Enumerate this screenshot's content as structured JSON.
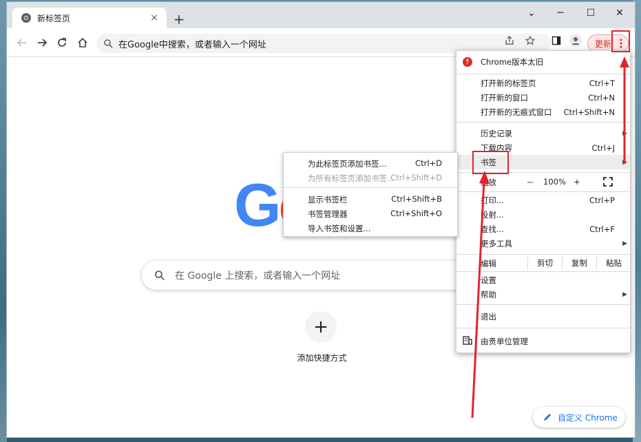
{
  "tab": {
    "title": "新标签页",
    "favicon": "chrome-icon",
    "close": "×"
  },
  "newtab": "+",
  "window_controls": {
    "minimize": "─",
    "maximize": "☐",
    "close": "✕",
    "tabsearch": "⌄"
  },
  "omnibox": {
    "text": "在Google中搜索，或者输入一个网址"
  },
  "update_button": {
    "label": "更新"
  },
  "page": {
    "logo_letters": [
      {
        "ch": "G",
        "color": "#4285f4"
      },
      {
        "ch": "o",
        "color": "#ea4335"
      }
    ],
    "search_placeholder": "在 Google 上搜索，或者输入一个网址",
    "shortcut_add": "+",
    "shortcut_label": "添加快捷方式",
    "customize_label": "自定义 Chrome"
  },
  "menu": {
    "update_notice": "Chrome版本太旧",
    "items_group1": [
      {
        "label": "打开新的标签页",
        "shortcut": "Ctrl+T"
      },
      {
        "label": "打开新的窗口",
        "shortcut": "Ctrl+N"
      },
      {
        "label": "打开新的无痕式窗口",
        "shortcut": "Ctrl+Shift+N"
      }
    ],
    "history": "历史记录",
    "downloads": {
      "label": "下载内容",
      "shortcut": "Ctrl+J"
    },
    "bookmarks": "书签",
    "zoom": {
      "label": "缩放",
      "minus": "－",
      "value": "100%",
      "plus": "+"
    },
    "items_group3": [
      {
        "label": "打印...",
        "shortcut": "Ctrl+P"
      },
      {
        "label": "投射...",
        "shortcut": ""
      },
      {
        "label": "查找...",
        "shortcut": "Ctrl+F"
      },
      {
        "label": "更多工具",
        "shortcut": ""
      }
    ],
    "edit": {
      "label": "编辑",
      "cut": "剪切",
      "copy": "复制",
      "paste": "粘贴"
    },
    "settings": "设置",
    "help": "帮助",
    "exit": "退出",
    "managed": "由贵单位管理"
  },
  "bookmarks_submenu": [
    {
      "label": "为此标签页添加书签...",
      "shortcut": "Ctrl+D",
      "disabled": false
    },
    {
      "label": "为所有标签页添加书签...",
      "shortcut": "Ctrl+Shift+D",
      "disabled": true
    },
    {
      "label": "显示书签栏",
      "shortcut": "Ctrl+Shift+B",
      "disabled": false
    },
    {
      "label": "书签管理器",
      "shortcut": "Ctrl+Shift+O",
      "disabled": false
    },
    {
      "label": "导入书签和设置...",
      "shortcut": "",
      "disabled": false
    }
  ],
  "annotation_color": "#e2232a"
}
